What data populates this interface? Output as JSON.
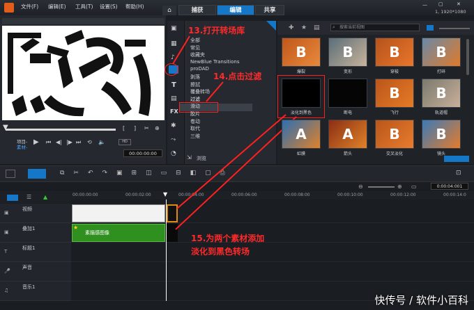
{
  "menubar": {
    "file": "文件(F)",
    "edit": "编辑(E)",
    "tools": "工具(T)",
    "settings": "设置(S)",
    "help": "帮助(H)"
  },
  "tabs": {
    "capture": "捕获",
    "edit": "编辑",
    "share": "共享"
  },
  "resolution": "1, 1920*1080",
  "preview": {
    "project": "项目-",
    "clip": "素材-",
    "timecode": "00:00:00:00"
  },
  "library": {
    "search_placeholder": "搜索当前视图",
    "categories": [
      "全部",
      "常见",
      "收藏夹",
      "NewBlue Transitions",
      "proDAD",
      "剥落",
      "擦拭",
      "覆叠转场",
      "过滤",
      "滑动",
      "胶片",
      "卷动",
      "取代",
      "三维"
    ],
    "browse": "浏览",
    "thumbs": [
      "爆裂",
      "变形",
      "穿梭",
      "打碎",
      "淡化到黑色",
      "断电",
      "飞行",
      "轨道帽",
      "虹膜",
      "箭头",
      "交叉淡化",
      "镜头"
    ]
  },
  "timeline": {
    "timecode": "0:00:04:001",
    "ruler": [
      "00:00:00:00",
      "00:00:02:00",
      "00:00:04:00",
      "00:00:06:00",
      "00:00:08:00",
      "00:00:10:00",
      "00:00:12:00",
      "00:00:14:0"
    ],
    "tracks": [
      "视频",
      "叠加1",
      "标题1",
      "声音",
      "音乐1"
    ],
    "overlay_clip": "素描感图像"
  },
  "annotations": {
    "a13": "13.打开转场库",
    "a14": "14.点击过滤",
    "a15_line1": "15.为两个素材添加",
    "a15_line2": "淡化到黑色转场"
  },
  "watermark": "快传号 / 软件小百科",
  "colors": {
    "accent": "#1577c7",
    "annotation": "#ff2020",
    "overlay_track": "#2f8f1f"
  }
}
